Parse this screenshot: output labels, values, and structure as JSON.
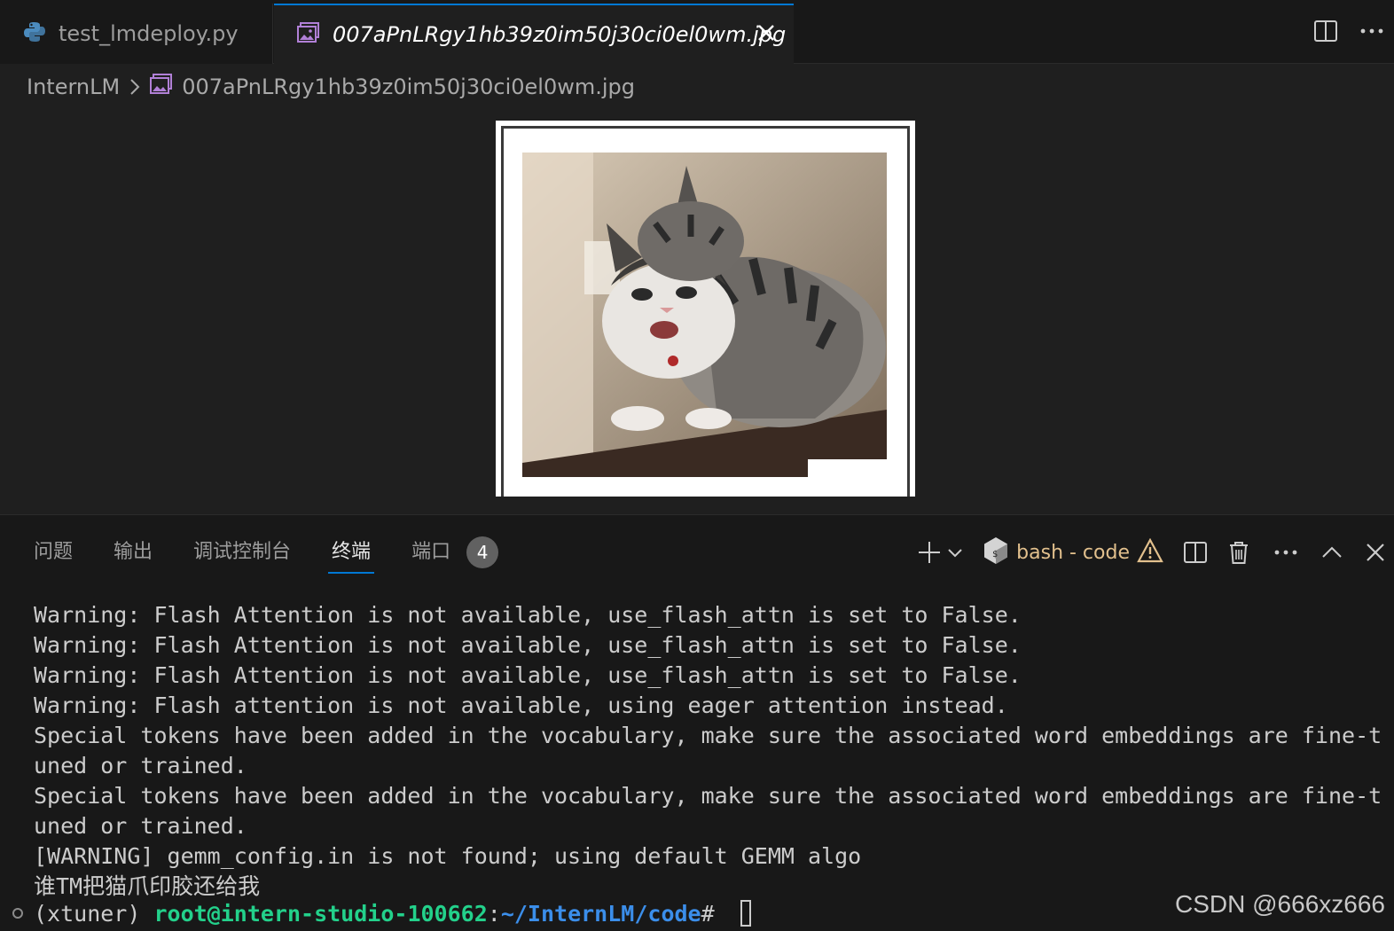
{
  "tabs": [
    {
      "label": "test_lmdeploy.py",
      "icon": "python-file-icon"
    },
    {
      "label": "007aPnLRgy1hb39z0im50j30ci0el0wm.jpg",
      "icon": "image-file-icon",
      "active": true
    }
  ],
  "breadcrumb": {
    "folder": "InternLM",
    "file": "007aPnLRgy1hb39z0im50j30ci0el0wm.jpg"
  },
  "panel": {
    "tabs": [
      "问题",
      "输出",
      "调试控制台",
      "终端",
      "端口"
    ],
    "active_tab": "终端",
    "ports_badge": "4",
    "terminal_name": "bash - code"
  },
  "terminal": {
    "lines": [
      "Warning: Flash Attention is not available, use_flash_attn is set to False.",
      "Warning: Flash Attention is not available, use_flash_attn is set to False.",
      "Warning: Flash Attention is not available, use_flash_attn is set to False.",
      "Warning: Flash attention is not available, using eager attention instead.",
      "Special tokens have been added in the vocabulary, make sure the associated word embeddings are fine-t",
      "uned or trained.",
      "Special tokens have been added in the vocabulary, make sure the associated word embeddings are fine-t",
      "uned or trained.",
      "[WARNING] gemm_config.in is not found; using default GEMM algo",
      "谁TM把猫爪印胶还给我"
    ],
    "prompt": {
      "env": "(xtuner) ",
      "user_host": "root@intern-studio-100662",
      "colon": ":",
      "path": "~/InternLM/code",
      "symbol": "# "
    }
  },
  "watermark": "CSDN @666xz666",
  "colors": {
    "accent": "#0078d4",
    "warning": "#e2c08d",
    "prompt_user": "#23d18b",
    "prompt_path": "#3b8eea"
  }
}
